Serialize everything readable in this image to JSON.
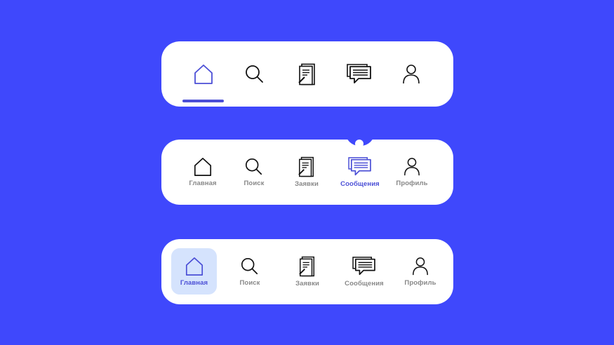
{
  "colors": {
    "background": "#3f48fc",
    "accent": "#4b4fd6",
    "highlight": "#d5e3fd",
    "label_gray": "#888888"
  },
  "bar1": {
    "items": [
      {
        "icon": "home-icon",
        "active": true
      },
      {
        "icon": "search-icon"
      },
      {
        "icon": "requests-icon"
      },
      {
        "icon": "messages-icon"
      },
      {
        "icon": "profile-icon"
      }
    ]
  },
  "bar2": {
    "items": [
      {
        "icon": "home-icon",
        "label": "Главная"
      },
      {
        "icon": "search-icon",
        "label": "Поиск"
      },
      {
        "icon": "requests-icon",
        "label": "Заявки"
      },
      {
        "icon": "messages-icon",
        "label": "Сообщения",
        "active": true
      },
      {
        "icon": "profile-icon",
        "label": "Профиль"
      }
    ]
  },
  "bar3": {
    "items": [
      {
        "icon": "home-icon",
        "label": "Главная",
        "active": true
      },
      {
        "icon": "search-icon",
        "label": "Поиск"
      },
      {
        "icon": "requests-icon",
        "label": "Заявки"
      },
      {
        "icon": "messages-icon",
        "label": "Сообщения"
      },
      {
        "icon": "profile-icon",
        "label": "Профиль"
      }
    ]
  }
}
